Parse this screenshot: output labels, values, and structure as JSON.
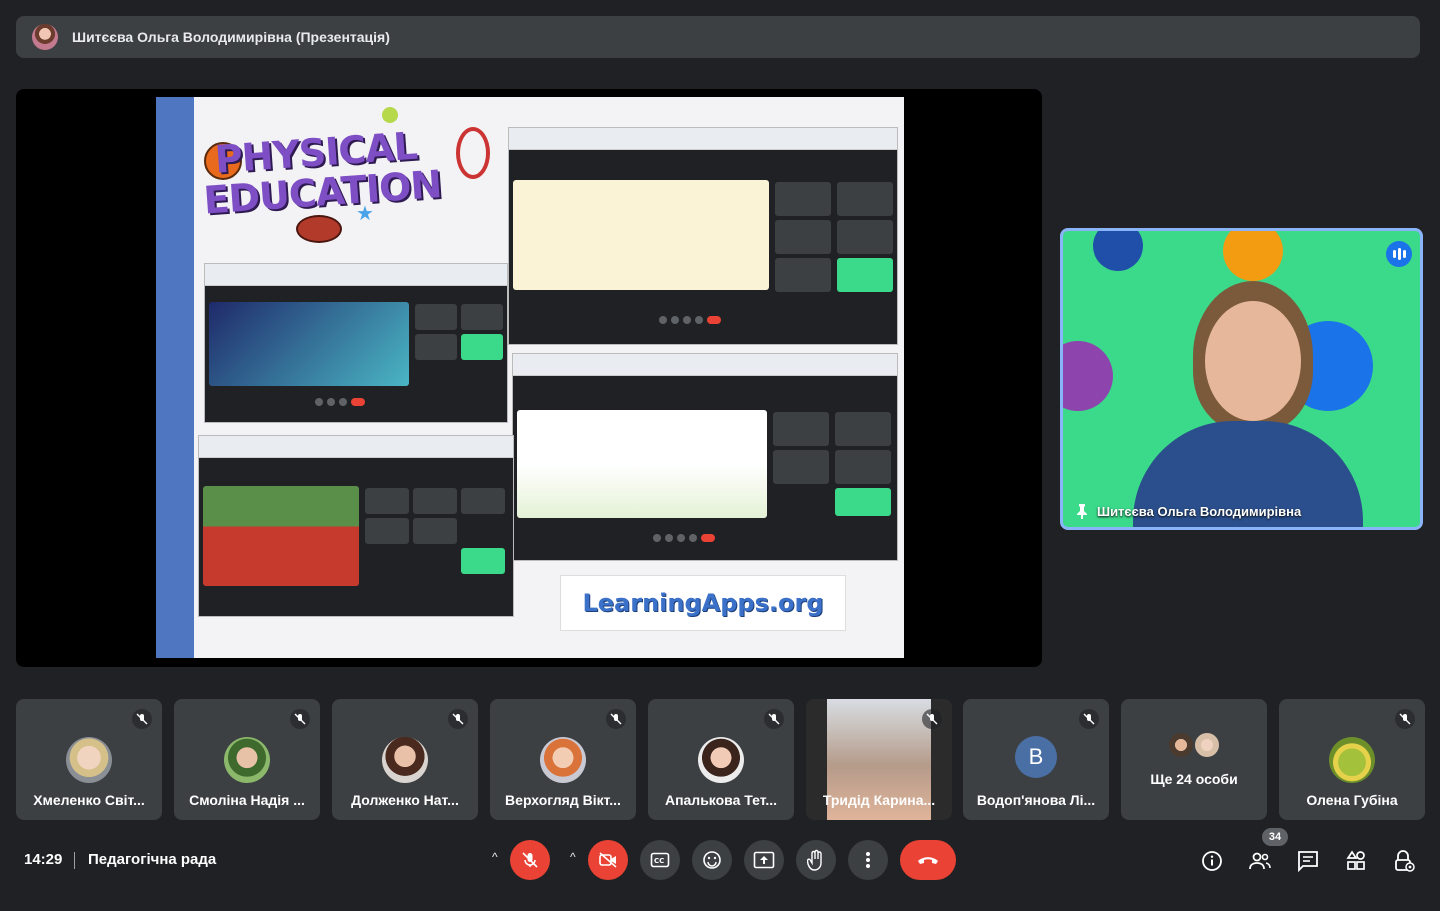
{
  "presenter_bar": {
    "title": "Шитєєва Ольга Володимирівна (Презентація)"
  },
  "slide": {
    "title_word1": "PHYSICAL",
    "title_word2": "EDUCATION",
    "logo_text": "LearningApps.org"
  },
  "pinned": {
    "name": "Шитєєва Ольга Володимирівна"
  },
  "participants": [
    {
      "name": "Хмеленко Світ...",
      "avatar_color": "#c9b7a5"
    },
    {
      "name": "Смоліна Надія ...",
      "avatar_color": "#6e8f4e"
    },
    {
      "name": "Долженко Нат...",
      "avatar_color": "#7a4b3a"
    },
    {
      "name": "Верхогляд Вікт...",
      "avatar_color": "#d99a6c"
    },
    {
      "name": "Апалькова Тет...",
      "avatar_color": "#5b3d31"
    },
    {
      "name": "Тридід Карина...",
      "avatar_color": "#b59b8a"
    },
    {
      "name": "Водоп'янова Лі...",
      "avatar_color": "#4a6fa5",
      "initial": "В"
    },
    {
      "name": "Олена Губіна",
      "avatar_color": "#a3c13a"
    }
  ],
  "more": {
    "label": "Ще 24 особи"
  },
  "bottom": {
    "time": "14:29",
    "meeting_name": "Педагогічна рада",
    "people_count": "34"
  },
  "colors": {
    "background": "#202124",
    "tile": "#3c4043",
    "danger": "#ea4335",
    "accent": "#8ab4f8"
  },
  "icons": [
    "mic-off-icon",
    "camera-off-icon",
    "captions-icon",
    "emoji-icon",
    "present-icon",
    "raise-hand-icon",
    "more-options-icon",
    "leave-call-icon",
    "info-icon",
    "people-icon",
    "chat-icon",
    "activities-icon",
    "host-controls-icon",
    "pin-icon"
  ]
}
